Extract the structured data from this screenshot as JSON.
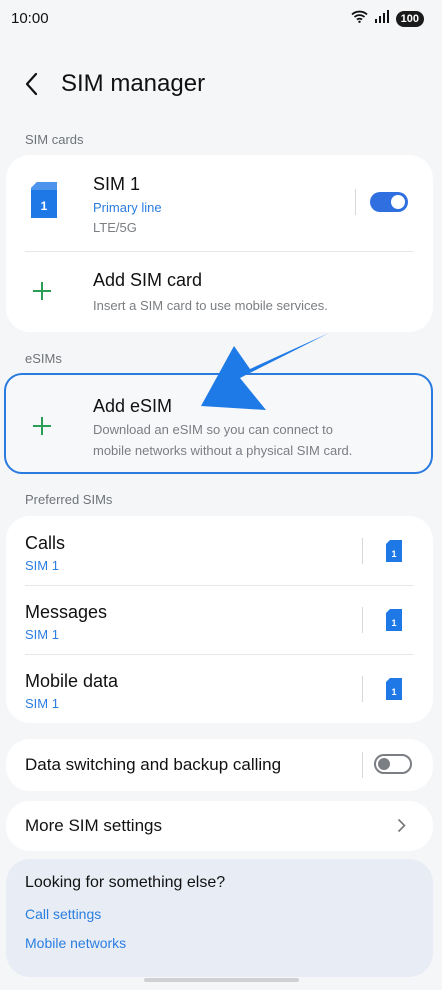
{
  "status": {
    "time": "10:00",
    "battery": "100"
  },
  "header": {
    "title": "SIM manager"
  },
  "sim_cards": {
    "section_label": "SIM cards",
    "sim1": {
      "name": "SIM 1",
      "line": "Primary line",
      "network": "LTE/5G",
      "toggle_on": true,
      "sim_number": "1"
    },
    "add_sim": {
      "title": "Add SIM card",
      "subtitle": "Insert a SIM card to use mobile services."
    }
  },
  "esims": {
    "section_label": "eSIMs",
    "add_esim": {
      "title": "Add eSIM",
      "subtitle_line1": "Download an eSIM so you can connect to",
      "subtitle_line2": "mobile networks without a physical SIM card."
    }
  },
  "preferred": {
    "section_label": "Preferred SIMs",
    "items": [
      {
        "title": "Calls",
        "value": "SIM 1",
        "sim_number": "1"
      },
      {
        "title": "Messages",
        "value": "SIM 1",
        "sim_number": "1"
      },
      {
        "title": "Mobile data",
        "value": "SIM 1",
        "sim_number": "1"
      }
    ]
  },
  "data_switching": {
    "title": "Data switching and backup calling",
    "toggle_on": false
  },
  "more_settings": {
    "title": "More SIM settings"
  },
  "help": {
    "title": "Looking for something else?",
    "links": [
      "Call settings",
      "Mobile networks"
    ]
  },
  "colors": {
    "accent": "#2b7ee0",
    "add_icon": "#2a9d57",
    "esim_outline": "#2a7be0"
  },
  "icons": [
    "wifi-icon",
    "signal-icon",
    "back-arrow-icon",
    "sim-card-icon",
    "plus-icon",
    "chevron-right-icon"
  ]
}
